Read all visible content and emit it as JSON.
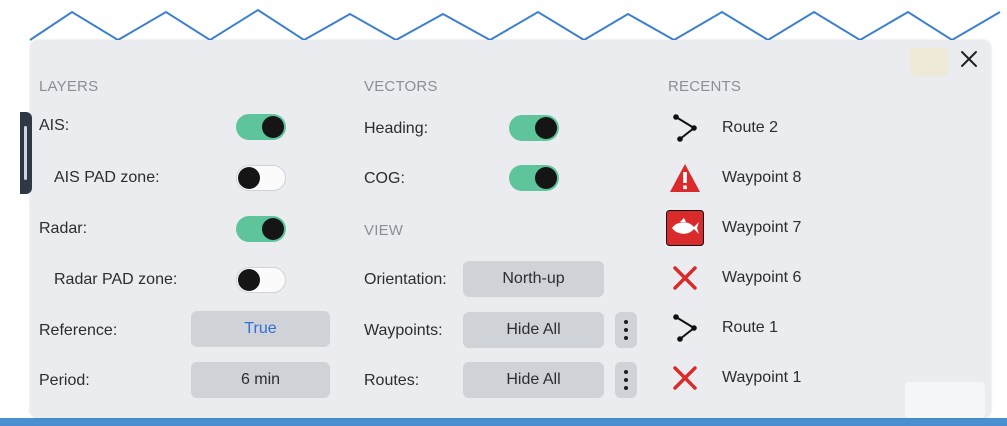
{
  "layers": {
    "title": "LAYERS",
    "ais_label": "AIS:",
    "ais_pad_label": "AIS PAD zone:",
    "radar_label": "Radar:",
    "radar_pad_label": "Radar PAD zone:",
    "reference_label": "Reference:",
    "reference_value": "True",
    "period_label": "Period:",
    "period_value": "6 min",
    "toggles": {
      "ais": true,
      "ais_pad": false,
      "radar": true,
      "radar_pad": false
    }
  },
  "vectors": {
    "title": "VECTORS",
    "heading_label": "Heading:",
    "cog_label": "COG:",
    "toggles": {
      "heading": true,
      "cog": true
    }
  },
  "view": {
    "title": "VIEW",
    "orientation_label": "Orientation:",
    "orientation_value": "North-up",
    "waypoints_label": "Waypoints:",
    "waypoints_value": "Hide All",
    "routes_label": "Routes:",
    "routes_value": "Hide All"
  },
  "recents": {
    "title": "RECENTS",
    "items": [
      {
        "label": "Route 2",
        "icon": "route-icon"
      },
      {
        "label": "Waypoint 8",
        "icon": "warning-icon"
      },
      {
        "label": "Waypoint 7",
        "icon": "fish-icon"
      },
      {
        "label": "Waypoint 6",
        "icon": "cross-icon"
      },
      {
        "label": "Route 1",
        "icon": "route-icon"
      },
      {
        "label": "Waypoint 1",
        "icon": "cross-icon"
      }
    ]
  },
  "colors": {
    "toggle_on": "#5ec49b",
    "accent_text": "#2f6fd6",
    "danger": "#d92b2b",
    "panel_bg": "#eaecef",
    "water": "#4a8fcf"
  }
}
